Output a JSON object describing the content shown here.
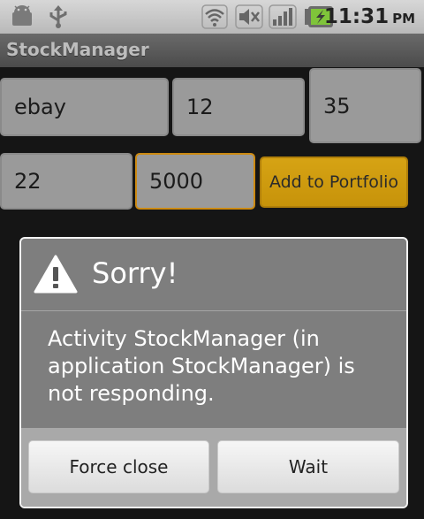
{
  "status_bar": {
    "time": "11:31",
    "ampm": "PM",
    "icons": [
      "android-debug-icon",
      "usb-icon",
      "wifi-icon",
      "mute-icon",
      "signal-icon",
      "battery-charging-icon"
    ]
  },
  "app": {
    "title": "StockManager"
  },
  "form": {
    "symbol": "ebay",
    "field2": "12",
    "field3": "35",
    "field4": "22",
    "field5": "5000",
    "add_button_label": "Add to Portfolio"
  },
  "dialog": {
    "title": "Sorry!",
    "message": "Activity StockManager (in application StockManager) is not responding.",
    "buttons": {
      "force_close": "Force close",
      "wait": "Wait"
    }
  },
  "colors": {
    "accent": "#cc8a12",
    "status_bar": "#c8c8c8",
    "dialog": "#7e7e7e"
  }
}
